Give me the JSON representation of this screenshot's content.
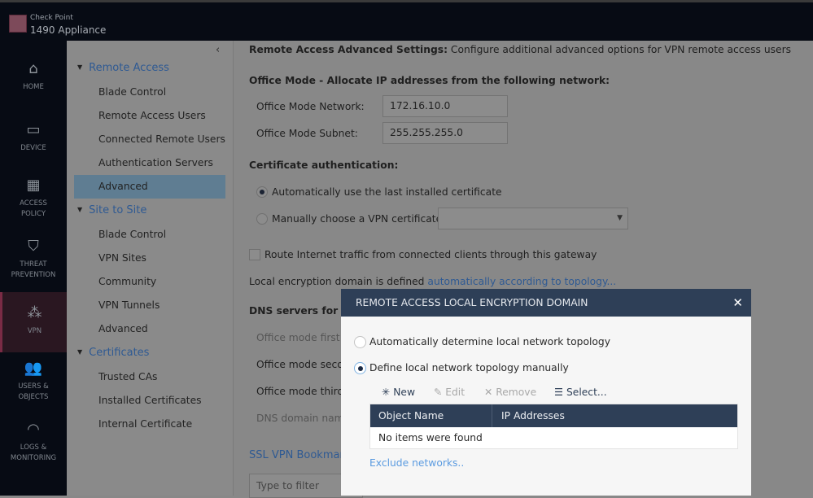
{
  "app": {
    "brand_line1": "Check Point",
    "brand_line2": "1490 Appliance"
  },
  "sidebar": {
    "items": [
      {
        "label": "HOME",
        "icon": "home-icon"
      },
      {
        "label": "DEVICE",
        "icon": "device-icon"
      },
      {
        "label": "ACCESS POLICY",
        "icon": "grid-icon"
      },
      {
        "label": "THREAT PREVENTION",
        "icon": "shield-icon"
      },
      {
        "label": "VPN",
        "icon": "vpn-network-icon",
        "active": true
      },
      {
        "label": "USERS & OBJECTS",
        "icon": "users-icon"
      },
      {
        "label": "LOGS & MONITORING",
        "icon": "gauge-icon"
      }
    ]
  },
  "tree": {
    "groups": [
      {
        "label": "Remote Access",
        "items": [
          "Blade Control",
          "Remote Access Users",
          "Connected Remote Users",
          "Authentication Servers",
          "Advanced"
        ]
      },
      {
        "label": "Site to Site",
        "items": [
          "Blade Control",
          "VPN Sites",
          "Community",
          "VPN Tunnels",
          "Advanced"
        ]
      },
      {
        "label": "Certificates",
        "items": [
          "Trusted CAs",
          "Installed Certificates",
          "Internal Certificate"
        ]
      }
    ],
    "selected": "Remote Access > Advanced"
  },
  "main": {
    "header_bold": "Remote Access Advanced Settings:",
    "header_text": "Configure additional advanced options for VPN remote access users",
    "office_mode_title": "Office Mode - Allocate IP addresses from the following network:",
    "network_label": "Office Mode Network:",
    "network_value": "172.16.10.0",
    "subnet_label": "Office Mode Subnet:",
    "subnet_value": "255.255.255.0",
    "cert_title": "Certificate authentication:",
    "cert_auto": "Automatically use the last installed certificate",
    "cert_manual": "Manually choose a VPN certificate:",
    "cert_select_value": "",
    "route_label": "Route Internet traffic from connected clients through this gateway",
    "route_checked": false,
    "encdomain_text": "Local encryption domain is defined",
    "encdomain_link": "automatically according to topology...",
    "dns_title": "DNS servers for Re",
    "dns_first": "Office mode first D",
    "dns_second": "Office mode secor",
    "dns_third": "Office mode third",
    "dns_domain": "DNS domain name",
    "ssl_title": "SSL VPN Bookmark",
    "filter_placeholder": "Type to filter"
  },
  "modal": {
    "title": "REMOTE ACCESS LOCAL ENCRYPTION DOMAIN",
    "opt_auto": "Automatically determine local network topology",
    "opt_manual": "Define local network topology manually",
    "selected_option": "manual",
    "toolbar": {
      "new": "New",
      "edit": "Edit",
      "remove": "Remove",
      "select": "Select..."
    },
    "columns": [
      "Object Name",
      "IP Addresses"
    ],
    "empty": "No items were found",
    "exclude_link": "Exclude networks.."
  },
  "colors": {
    "modal_header": "#2e3f57",
    "link": "#2f5a93",
    "active_nav": "#7a2b45"
  }
}
